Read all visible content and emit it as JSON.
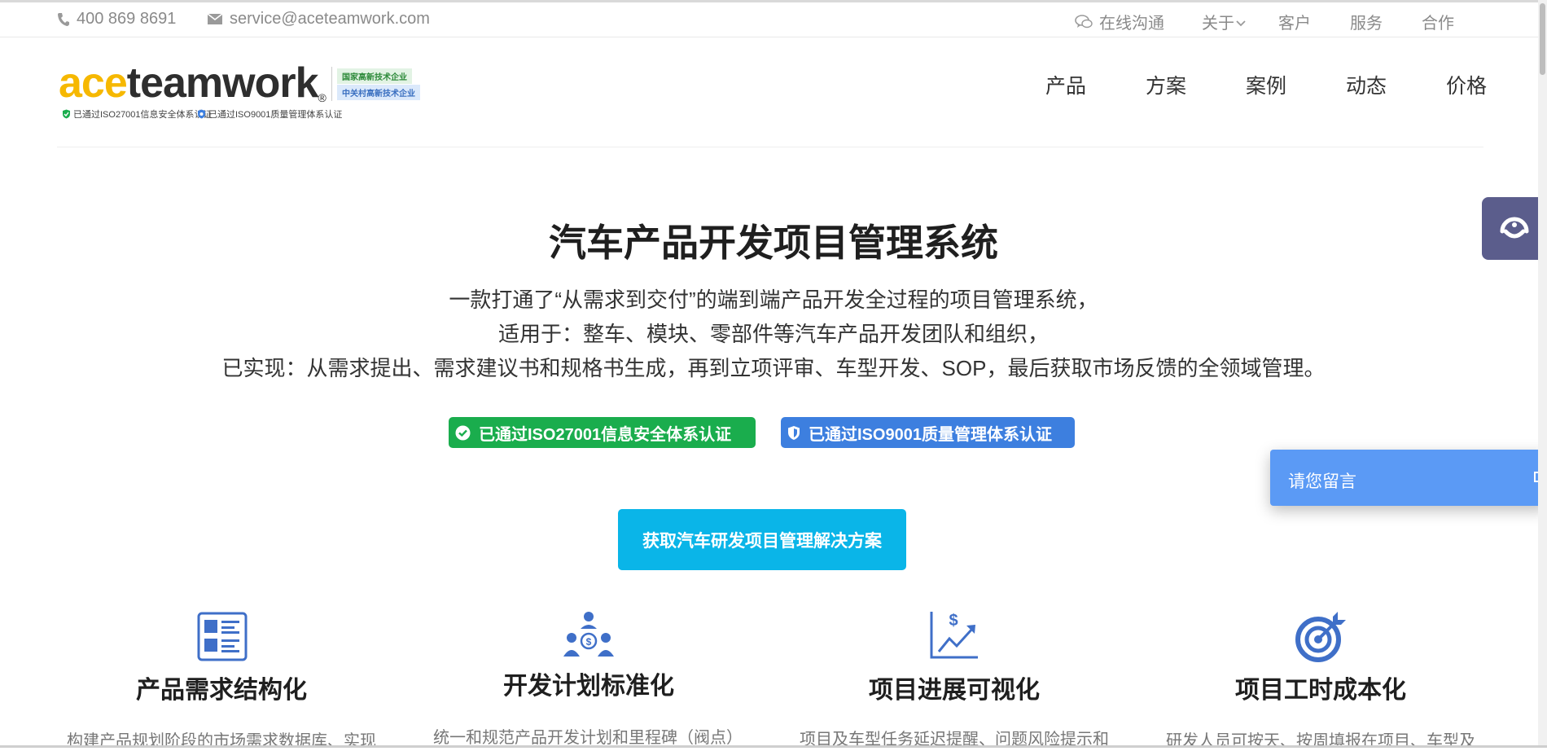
{
  "topbar": {
    "phone": "400 869 8691",
    "email": "service@aceteamwork.com",
    "chat": "在线沟通",
    "about": "关于",
    "customers": "客户",
    "services": "服务",
    "cooperation": "合作"
  },
  "logo": {
    "ace": "ace",
    "teamwork": "teamwork",
    "reg": "®",
    "badge1": "国家高新技术企业",
    "badge2": "中关村高新技术企业",
    "iso1": "已通过ISO27001信息安全体系认证",
    "iso2": "已通过ISO9001质量管理体系认证"
  },
  "nav": [
    "产品",
    "方案",
    "案例",
    "动态",
    "价格"
  ],
  "hero": {
    "title": "汽车产品开发项目管理系统",
    "line1": "一款打通了“从需求到交付”的端到端产品开发全过程的项目管理系统，",
    "line2": "适用于：整车、模块、零部件等汽车产品开发团队和组织，",
    "line3": "已实现：从需求提出、需求建议书和规格书生成，再到立项评审、车型开发、SOP，最后获取市场反馈的全领域管理。",
    "cert1": "已通过ISO27001信息安全体系认证",
    "cert2": "已通过ISO9001质量管理体系认证",
    "cta": "获取汽车研发项目管理解决方案"
  },
  "features": [
    {
      "title": "产品需求结构化",
      "desc": "构建产品规划阶段的市场需求数据库、实现",
      "icon": "document-list-icon"
    },
    {
      "title": "开发计划标准化",
      "desc": "统一和规范产品开发计划和里程碑（阀点）",
      "icon": "team-money-icon"
    },
    {
      "title": "项目进展可视化",
      "desc": "项目及车型任务延迟提醒、问题风险提示和",
      "icon": "growth-chart-icon"
    },
    {
      "title": "项目工时成本化",
      "desc": "研发人员可按天、按周填报在项目、车型及",
      "icon": "target-icon"
    }
  ],
  "widgets": {
    "message": "请您留言"
  },
  "colors": {
    "accent": "#0ab5e8",
    "logo_yellow": "#f6b800",
    "cert_green": "#1aad4d",
    "cert_blue": "#3d7fdf",
    "feature_icon": "#3f6fc8",
    "message_panel": "#5b9af5",
    "side_button": "#5b5d8c"
  }
}
